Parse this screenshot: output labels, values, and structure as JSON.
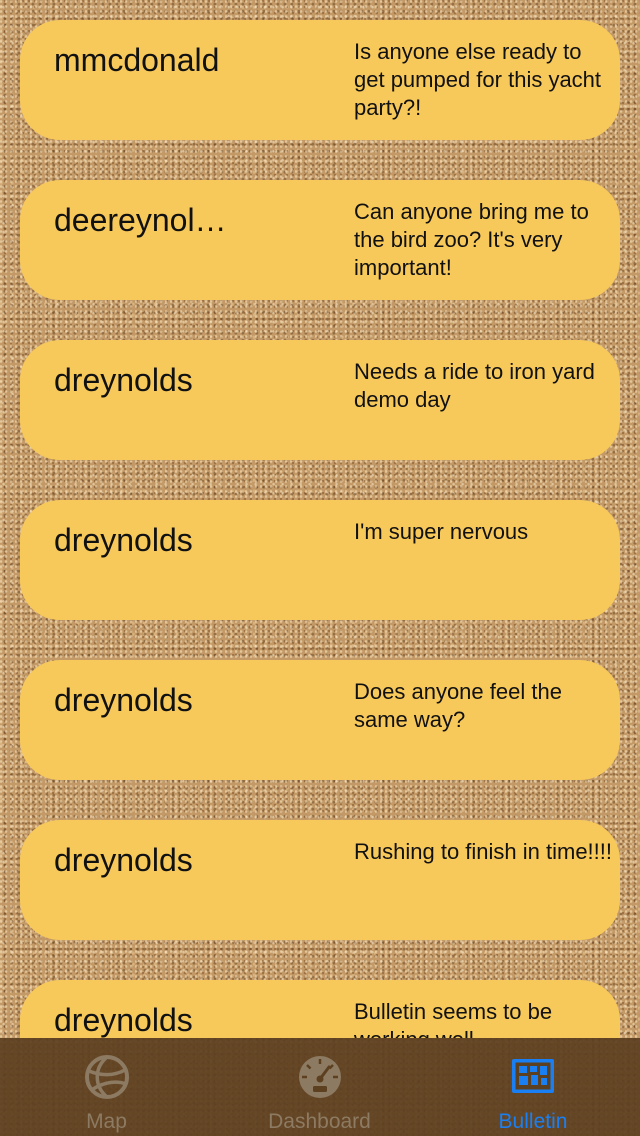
{
  "bulletin": {
    "posts": [
      {
        "username": "mmcdonald",
        "message": "Is anyone else ready to get pumped for this yacht party?!"
      },
      {
        "username": "deereynol…",
        "message": "Can anyone bring me to the bird zoo? It's very important!"
      },
      {
        "username": "dreynolds",
        "message": "Needs a ride to iron yard demo day"
      },
      {
        "username": "dreynolds",
        "message": "I'm super nervous"
      },
      {
        "username": "dreynolds",
        "message": "Does anyone feel the same way?"
      },
      {
        "username": "dreynolds",
        "message": "Rushing to finish in time!!!!"
      },
      {
        "username": "dreynolds",
        "message": "Bulletin seems to be working well"
      }
    ]
  },
  "tabbar": {
    "tabs": [
      {
        "label": "Map",
        "icon": "globe-icon"
      },
      {
        "label": "Dashboard",
        "icon": "gauge-icon"
      },
      {
        "label": "Bulletin",
        "icon": "bulletin-board-icon"
      }
    ],
    "selected": "Bulletin"
  },
  "colors": {
    "card": "#f7c85a",
    "tabbar": "#5c4020",
    "tab_inactive": "#8d7a62",
    "tab_active": "#1a7ff2",
    "corkboard": "#c39a67"
  }
}
